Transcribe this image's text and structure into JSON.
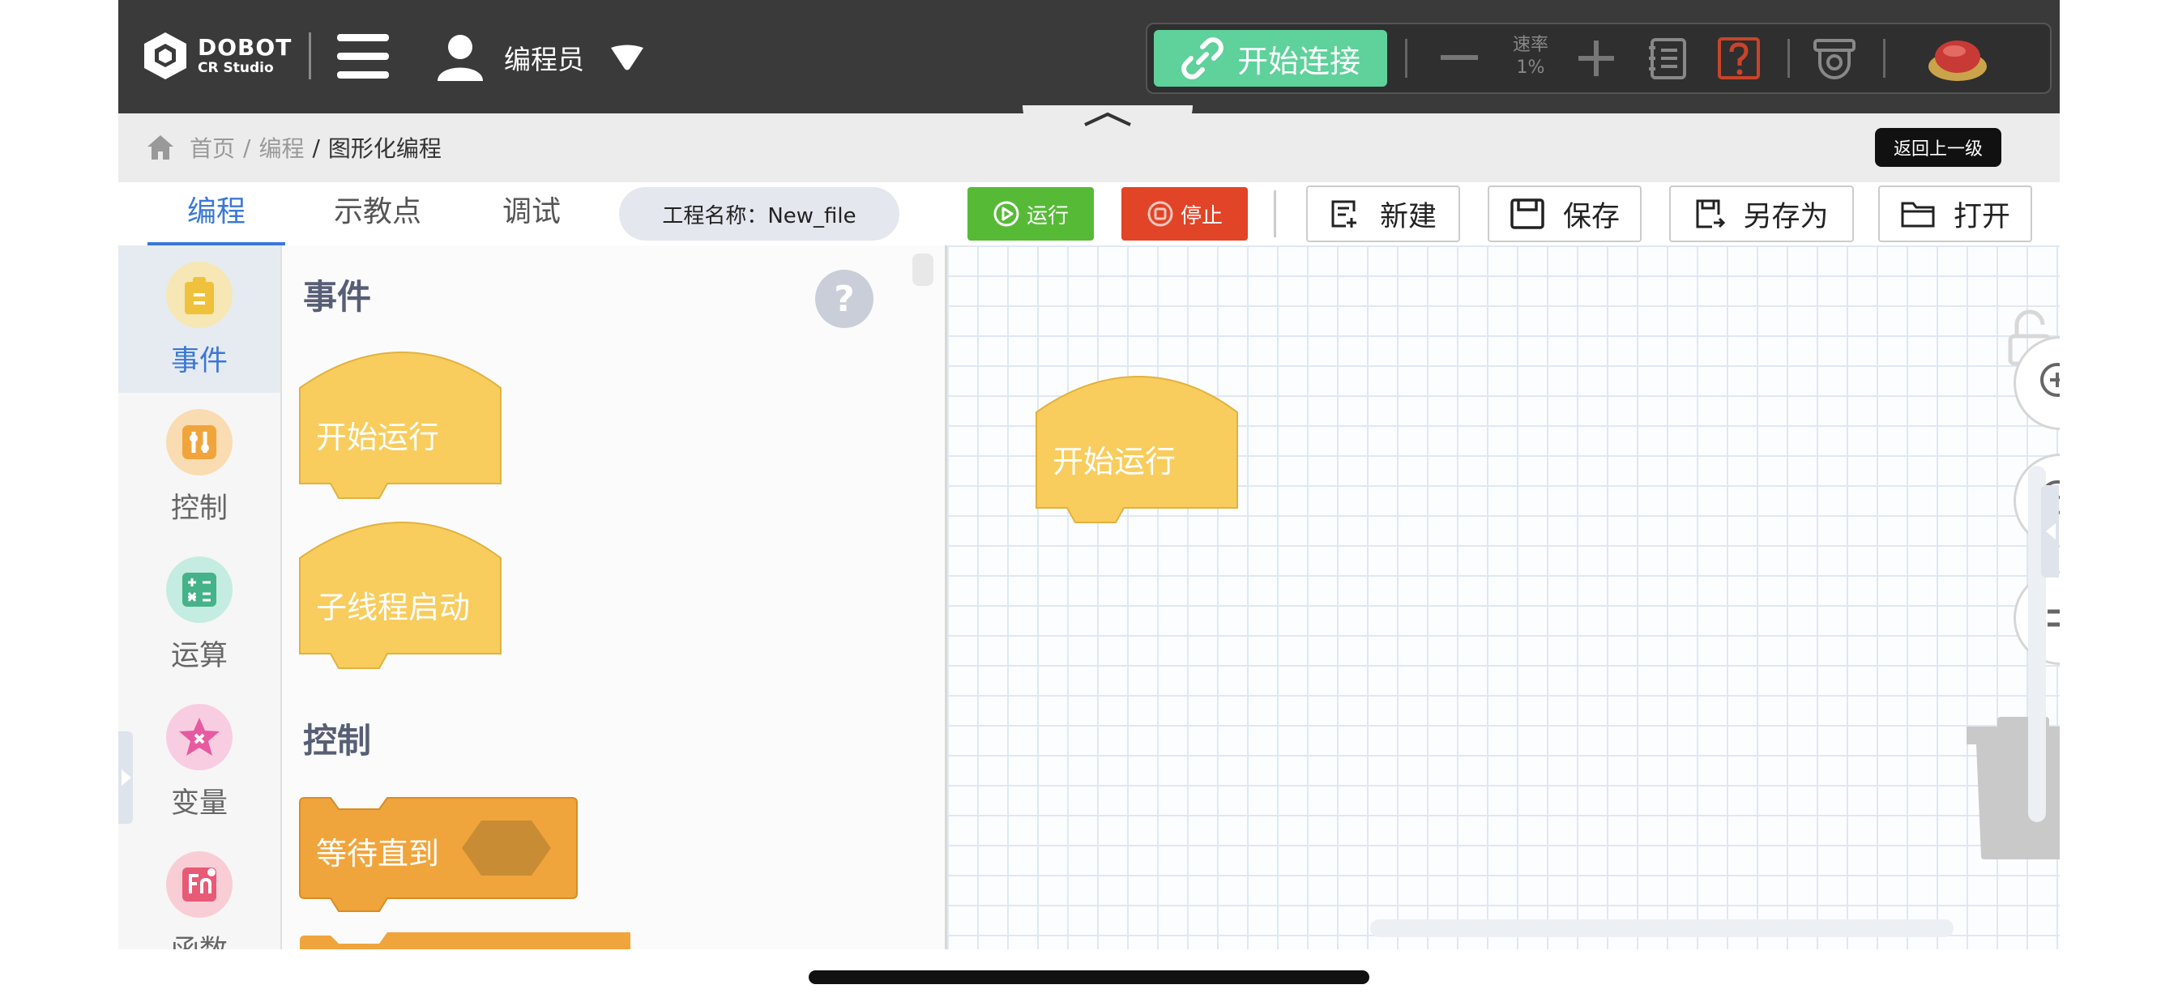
{
  "topbar": {
    "logo_line1": "DOBOT",
    "logo_line2": "CR Studio",
    "user_name": "编程员",
    "connect_label": "开始连接",
    "speed_label": "速率",
    "speed_value": "1%"
  },
  "breadcrumb": {
    "items": [
      "首页",
      "编程",
      "图形化编程"
    ],
    "back_label": "返回上一级"
  },
  "tabs": [
    {
      "label": "编程",
      "active": true
    },
    {
      "label": "示教点",
      "active": false
    },
    {
      "label": "调试",
      "active": false
    }
  ],
  "project_name": "工程名称：New_file",
  "actions": {
    "run": "运行",
    "stop": "停止",
    "new": "新建",
    "save": "保存",
    "save_as": "另存为",
    "open": "打开"
  },
  "categories": [
    {
      "label": "事件",
      "color": "#f8cd5d",
      "active": true
    },
    {
      "label": "控制",
      "color": "#f0a53c",
      "active": false
    },
    {
      "label": "运算",
      "color": "#45b28a",
      "active": false
    },
    {
      "label": "变量",
      "color": "#e85aa0",
      "active": false
    },
    {
      "label": "函数",
      "color": "#e85a75",
      "active": false
    }
  ],
  "palette": {
    "events_title": "事件",
    "event_blocks": [
      "开始运行",
      "子线程启动"
    ],
    "control_title": "控制",
    "control_blocks": [
      "等待直到"
    ]
  },
  "workspace": {
    "blocks": [
      "开始运行"
    ]
  },
  "colors": {
    "topbar": "#3a3a3a",
    "connect": "#5fd19b",
    "accent": "#3a78d6",
    "run": "#57ba37",
    "stop": "#e14426",
    "event_block": "#f8cd5d",
    "control_block": "#f0a53c"
  }
}
